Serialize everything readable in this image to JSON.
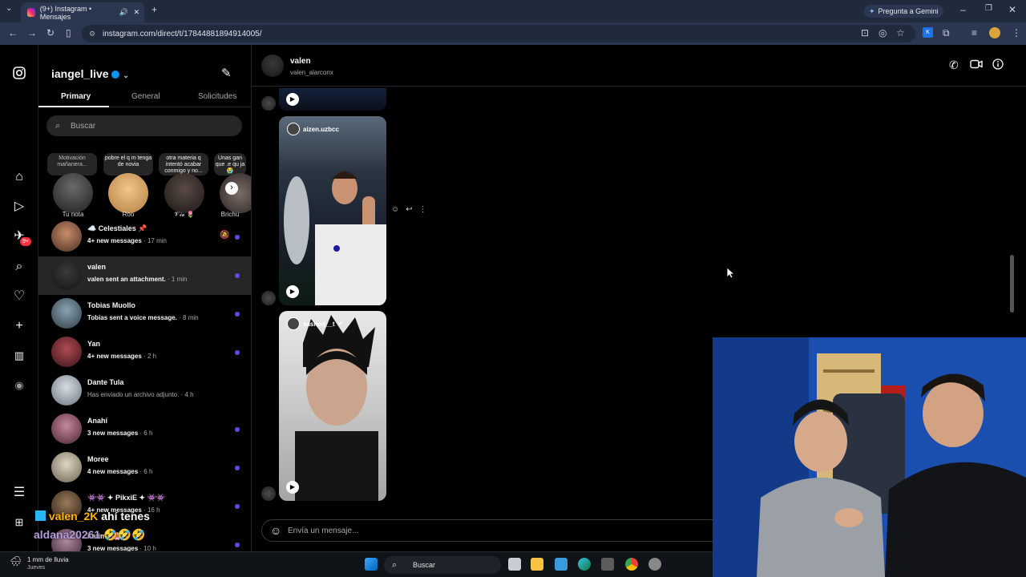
{
  "browser": {
    "tab_title": "(9+) Instagram • Mensajes",
    "url": "instagram.com/direct/t/17844881894914005/",
    "gemini_label": "Pregunta a Gemini"
  },
  "sidebar": {
    "username": "iangel_live",
    "tabs": [
      "Primary",
      "General",
      "Solicitudes"
    ],
    "search_placeholder": "Buscar",
    "notes": [
      {
        "text": "Motivación mañanera...",
        "name": "Tu nota"
      },
      {
        "text": "pobre el q m tenga de novia",
        "name": "Roo"
      },
      {
        "text": "otra materia q intentó acabar conmigo y no...",
        "name": "𝓥𝓲𝓮 🌷"
      },
      {
        "text": "Unas gan que .e qu ja 😭",
        "name": "Brichu"
      }
    ],
    "conversations": [
      {
        "name": "☁️ Celestiales 📌",
        "subtitle": "4+ new messages",
        "time": "· 17 min",
        "unread": true
      },
      {
        "name": "valen",
        "subtitle": "valen sent an attachment.",
        "time": "· 1 min",
        "unread": true
      },
      {
        "name": "Tobias Muollo",
        "subtitle": "Tobias sent a voice message.",
        "time": "· 8 min",
        "unread": true
      },
      {
        "name": "Yan",
        "subtitle": "4+ new messages",
        "time": "· 2 h",
        "unread": true
      },
      {
        "name": "Dante Tula",
        "subtitle": "Has enviado un archivo adjunto.",
        "time": "· 4 h",
        "unread": false
      },
      {
        "name": "Anahí",
        "subtitle": "3 new messages",
        "time": "· 6 h",
        "unread": true
      },
      {
        "name": "Moree",
        "subtitle": "4 new messages",
        "time": "· 6 h",
        "unread": true
      },
      {
        "name": "👾👾 ✦ PikxiE ✦ 👾👾",
        "subtitle": "4+ new messages",
        "time": "· 16 h",
        "unread": true
      },
      {
        "name": "Fatima 🌸",
        "subtitle": "3 new messages",
        "time": "· 10 h",
        "unread": true
      }
    ],
    "notification_badge": "9+"
  },
  "chat": {
    "name": "valen",
    "handle": "valen_alarconx",
    "post1_user": "aizen.uzbcc",
    "post2_user": "sashod__t",
    "composer_placeholder": "Envía un mensaje..."
  },
  "stream_overlay": {
    "line1_user": "valen_2K",
    "line1_msg": "ahí tenes",
    "line2_user": "aldana20261",
    "line2_msg": "🤣🤣🤣"
  },
  "taskbar": {
    "weather": "1 mm de lluvia",
    "weather_day": "Jueves",
    "search_label": "Buscar"
  }
}
